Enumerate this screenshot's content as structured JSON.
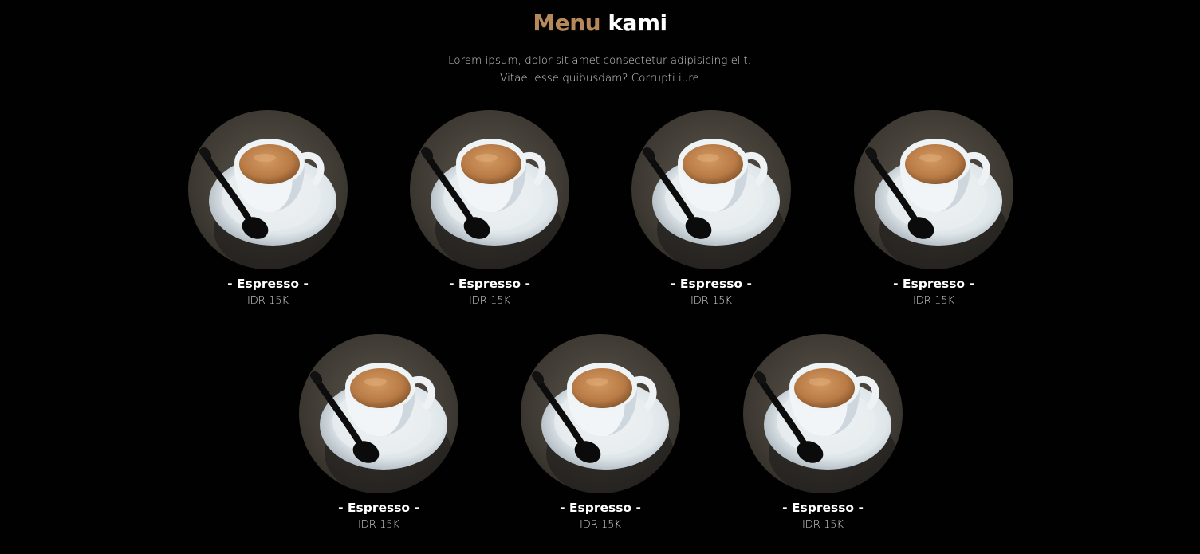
{
  "section": {
    "title_accent": "Menu",
    "title_rest": "kami",
    "subtitle_line1": "Lorem ipsum, dolor sit amet consectetur adipisicing elit.",
    "subtitle_line2": "Vitae, esse quibusdam? Corrupti iure"
  },
  "colors": {
    "accent": "#b6895b",
    "background": "#010101"
  },
  "menu": {
    "items": [
      {
        "name": "- Espresso -",
        "price": "IDR 15K",
        "image": "espresso-cup-photo"
      },
      {
        "name": "- Espresso -",
        "price": "IDR 15K",
        "image": "espresso-cup-photo"
      },
      {
        "name": "- Espresso -",
        "price": "IDR 15K",
        "image": "espresso-cup-photo"
      },
      {
        "name": "- Espresso -",
        "price": "IDR 15K",
        "image": "espresso-cup-photo"
      },
      {
        "name": "- Espresso -",
        "price": "IDR 15K",
        "image": "espresso-cup-photo"
      },
      {
        "name": "- Espresso -",
        "price": "IDR 15K",
        "image": "espresso-cup-photo"
      },
      {
        "name": "- Espresso -",
        "price": "IDR 15K",
        "image": "espresso-cup-photo"
      }
    ]
  }
}
